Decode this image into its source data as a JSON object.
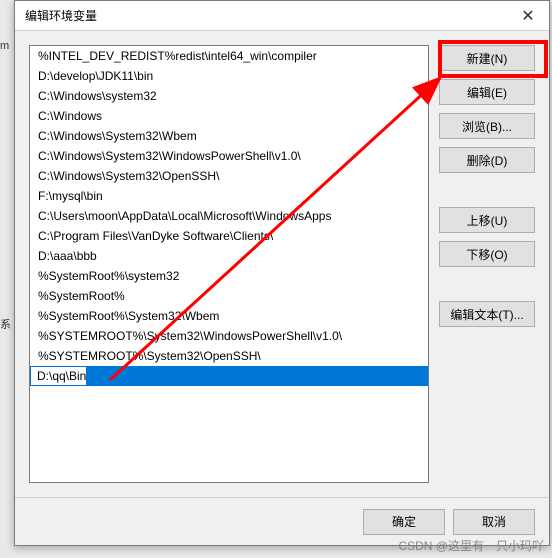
{
  "dialog": {
    "title": "编辑环境变量"
  },
  "list": {
    "items": [
      "%INTEL_DEV_REDIST%redist\\intel64_win\\compiler",
      "D:\\develop\\JDK11\\bin",
      "C:\\Windows\\system32",
      "C:\\Windows",
      "C:\\Windows\\System32\\Wbem",
      "C:\\Windows\\System32\\WindowsPowerShell\\v1.0\\",
      "C:\\Windows\\System32\\OpenSSH\\",
      "F:\\mysql\\bin",
      "C:\\Users\\moon\\AppData\\Local\\Microsoft\\WindowsApps",
      "C:\\Program Files\\VanDyke Software\\Clients\\",
      "D:\\aaa\\bbb",
      "%SystemRoot%\\system32",
      "%SystemRoot%",
      "%SystemRoot%\\System32\\Wbem",
      "%SYSTEMROOT%\\System32\\WindowsPowerShell\\v1.0\\",
      "%SYSTEMROOT%\\System32\\OpenSSH\\"
    ],
    "editing_value": "D:\\qq\\Bin"
  },
  "buttons": {
    "new": "新建(N)",
    "edit": "编辑(E)",
    "browse": "浏览(B)...",
    "delete": "删除(D)",
    "move_up": "上移(U)",
    "move_down": "下移(O)",
    "edit_text": "编辑文本(T)...",
    "ok": "确定",
    "cancel": "取消"
  },
  "annotation": {
    "highlight_color": "#ff0000"
  },
  "watermark": "CSDN @这里有一只小玛吖",
  "left_labels": {
    "m": "m",
    "s": "系"
  }
}
